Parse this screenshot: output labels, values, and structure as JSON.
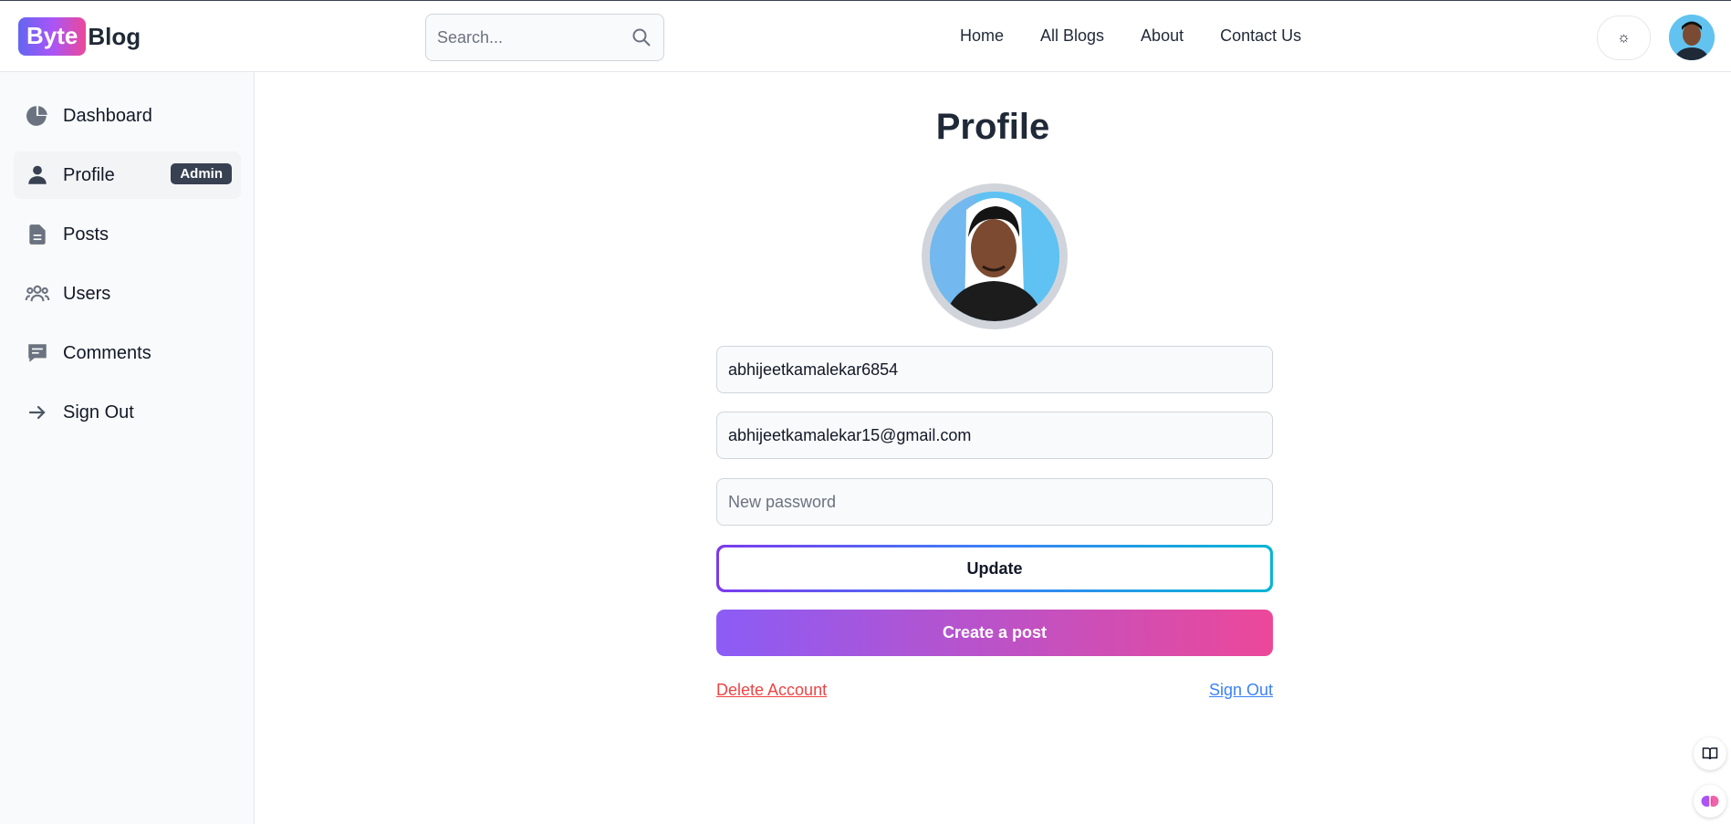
{
  "header": {
    "logo_badge": "Byte",
    "logo_text": "Blog",
    "search_placeholder": "Search...",
    "nav": [
      "Home",
      "All Blogs",
      "About",
      "Contact Us"
    ],
    "theme_toggle": "☼"
  },
  "sidebar": {
    "items": [
      {
        "label": "Dashboard",
        "icon": "pie-chart-icon"
      },
      {
        "label": "Profile",
        "icon": "user-icon",
        "badge": "Admin",
        "active": true
      },
      {
        "label": "Posts",
        "icon": "document-icon"
      },
      {
        "label": "Users",
        "icon": "users-icon"
      },
      {
        "label": "Comments",
        "icon": "comment-icon"
      },
      {
        "label": "Sign Out",
        "icon": "arrow-right-icon"
      }
    ]
  },
  "main": {
    "title": "Profile",
    "username_value": "abhijeetkamalekar6854",
    "email_value": "abhijeetkamalekar15@gmail.com",
    "password_placeholder": "New password",
    "update_label": "Update",
    "create_post_label": "Create a post",
    "delete_account_label": "Delete Account",
    "sign_out_label": "Sign Out"
  },
  "colors": {
    "accent_gradient_start": "#8b5cf6",
    "accent_gradient_end": "#ec4899",
    "danger": "#ef4444",
    "link": "#3b82f6"
  }
}
